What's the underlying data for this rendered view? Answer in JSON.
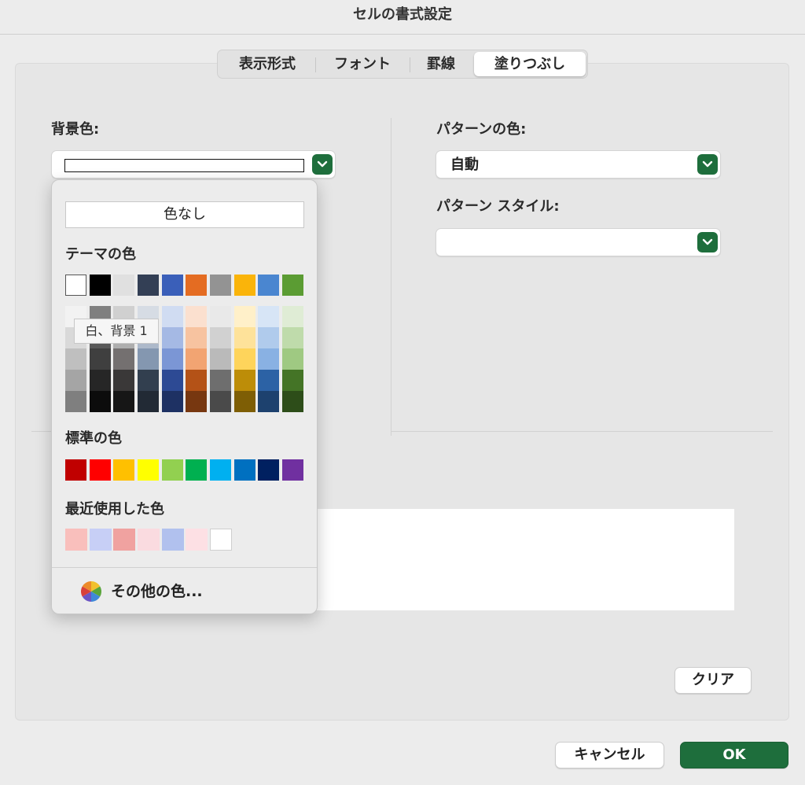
{
  "window": {
    "title": "セルの書式設定"
  },
  "tabs": [
    "表示形式",
    "フォント",
    "罫線",
    "塗りつぶし"
  ],
  "active_tab": "塗りつぶし",
  "background": {
    "label": "背景色:"
  },
  "pattern": {
    "color_label": "パターンの色:",
    "color_value": "自動",
    "style_label": "パターン スタイル:",
    "style_value": ""
  },
  "color_panel": {
    "no_color_label": "色なし",
    "theme_label": "テーマの色",
    "theme_base": [
      "#ffffff",
      "#000000",
      "#e0e0e0",
      "#333f55",
      "#3a5fb9",
      "#e46c22",
      "#939393",
      "#fab40a",
      "#4a86d0",
      "#5b9c33"
    ],
    "theme_shades": [
      [
        "#f2f2f2",
        "#7f7f7f",
        "#d0d0d0",
        "#d6dce4",
        "#d0dcf2",
        "#fbe0cf",
        "#e9e9e9",
        "#fff0c9",
        "#d7e5f6",
        "#dfecd5"
      ],
      [
        "#d9d9d9",
        "#595959",
        "#aeaeae",
        "#adb9ca",
        "#a5b9e4",
        "#f7c3a0",
        "#d1d1d1",
        "#fee29a",
        "#b0cbec",
        "#bfdbab"
      ],
      [
        "#bfbfbf",
        "#3f3f3f",
        "#747070",
        "#8497b0",
        "#7b96d5",
        "#f2a472",
        "#bababa",
        "#fed45b",
        "#89b1e3",
        "#9fc982"
      ],
      [
        "#a5a5a5",
        "#262626",
        "#3a3838",
        "#323f4f",
        "#2d4a94",
        "#b45217",
        "#6e6e6e",
        "#bd8d08",
        "#2c62a5",
        "#447426"
      ],
      [
        "#7f7f7f",
        "#0c0c0c",
        "#161616",
        "#222a35",
        "#1e3163",
        "#773710",
        "#4a4a4a",
        "#7e5e05",
        "#1d416e",
        "#2d4d19"
      ]
    ],
    "standard_label": "標準の色",
    "standard_colors": [
      "#c00000",
      "#ff0000",
      "#ffc000",
      "#ffff00",
      "#92d050",
      "#00b050",
      "#00b0f0",
      "#0070c0",
      "#002060",
      "#7030a0"
    ],
    "recent_label": "最近使用した色",
    "recent_colors": [
      "#f9bfbc",
      "#c7cff6",
      "#f0a2a0",
      "#fadbe0",
      "#b1c1ee",
      "#fde0e4",
      "#ffffff"
    ],
    "more_colors_label": "その他の色...",
    "tooltip": "白、背景 1"
  },
  "buttons": {
    "clear": "クリア",
    "cancel": "キャンセル",
    "ok": "OK"
  },
  "colors": {
    "accent_green": "#1e6e3c"
  }
}
